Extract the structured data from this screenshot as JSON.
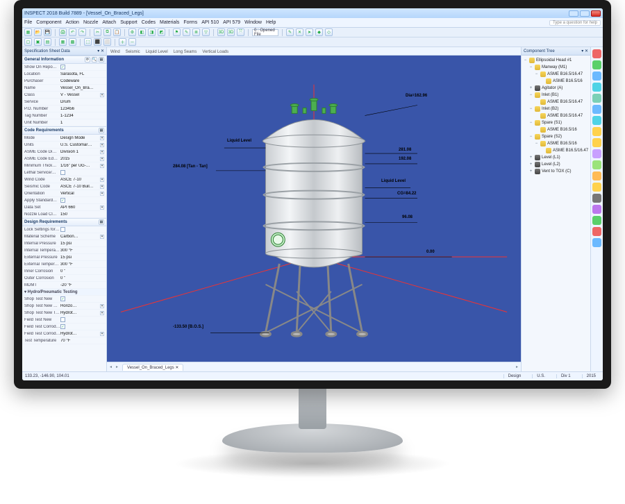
{
  "title": "INSPECT 2018 Build 7889 - [Vessel_On_Braced_Legs]",
  "menus": [
    "File",
    "Component",
    "Action",
    "Nozzle",
    "Attach",
    "Support",
    "Codes",
    "Materials",
    "Forms",
    "API 510",
    "API 579",
    "Window",
    "Help"
  ],
  "help_placeholder": "Type a question for help",
  "toolbar2": {
    "opened_file_label": "0 : Opened File"
  },
  "view_tabs": [
    "Wind",
    "Seismic",
    "Liquid Level",
    "Long Seams",
    "Vertical Loads"
  ],
  "doc_tab": "Vessel_On_Braced_Legs",
  "status": {
    "coords": "133.23, -146.90, 104.01",
    "design": "Design",
    "units": "U.S.",
    "div": "Div 1",
    "year": "2015"
  },
  "left_panel_title": "Specification Sheet Data",
  "right_panel_title": "Component Tree",
  "general": {
    "title": "General Information",
    "rows": [
      {
        "k": "Show On Repo…",
        "v": "",
        "check": true,
        "checked": true
      },
      {
        "k": "Location",
        "v": "Sarasota, FL"
      },
      {
        "k": "Purchaser",
        "v": "Codeware"
      },
      {
        "k": "Name",
        "v": "Vessel_On_Bra…"
      },
      {
        "k": "Class",
        "v": "V - Vessel",
        "dd": true
      },
      {
        "k": "Service",
        "v": "Drum"
      },
      {
        "k": "P.O. Number",
        "v": "123456"
      },
      {
        "k": "Tag Number",
        "v": "1-1234"
      },
      {
        "k": "Unit Number",
        "v": "1"
      }
    ]
  },
  "code": {
    "title": "Code Requirements",
    "rows": [
      {
        "k": "Mode",
        "v": "Design Mode",
        "dd": true
      },
      {
        "k": "Units",
        "v": "U.S. Customar…",
        "dd": true
      },
      {
        "k": "ASME Code Di…",
        "v": "Division 1",
        "dd": true
      },
      {
        "k": "ASME Code Ed…",
        "v": "2015",
        "dd": true
      },
      {
        "k": "Minimum Thick…",
        "v": "1/16\" per UG-…",
        "dd": true
      },
      {
        "k": "Lethal Service/…",
        "v": "",
        "check": true,
        "checked": false
      },
      {
        "k": "Wind Code",
        "v": "ASCE 7-10",
        "dd": true
      },
      {
        "k": "Seismic Code",
        "v": "ASCE 7-10 Buil…",
        "dd": true
      },
      {
        "k": "Orientation",
        "v": "Vertical",
        "dd": true
      },
      {
        "k": "Apply Standard…",
        "v": "",
        "check": true,
        "checked": true
      },
      {
        "k": "Data Set",
        "v": "API 660",
        "dd": true
      },
      {
        "k": "Nozzle Load Cl…",
        "v": "150"
      }
    ]
  },
  "design": {
    "title": "Design Requirements",
    "rows": [
      {
        "k": "Lock Settings for Indivi…",
        "v": "",
        "check": true,
        "checked": false
      },
      {
        "k": "Material Scheme",
        "v": "Carbon…",
        "dd": true
      },
      {
        "k": "Internal Pressure",
        "v": "15 psi"
      },
      {
        "k": "Internal Temperature",
        "v": "300 °F"
      },
      {
        "k": "External Pressure",
        "v": "15 psi"
      },
      {
        "k": "External Temperature",
        "v": "300 °F"
      },
      {
        "k": "Inner Corrosion",
        "v": "0 \""
      },
      {
        "k": "Outer Corrosion",
        "v": "0 \""
      },
      {
        "k": "MDMT",
        "v": "-20 °F"
      },
      {
        "k": "Hydro/Pneumatic Testing",
        "section": true
      },
      {
        "k": "Shop Test New",
        "v": "",
        "check": true,
        "checked": true
      },
      {
        "k": "Shop Test New Ori…",
        "v": "Horizo…",
        "dd": true
      },
      {
        "k": "Shop Test New Te…",
        "v": "Hydrot…",
        "dd": true
      },
      {
        "k": "Field Test New",
        "v": "",
        "check": true,
        "checked": false
      },
      {
        "k": "Field Test Corroded",
        "v": "",
        "check": true,
        "checked": true
      },
      {
        "k": "Field Test Corroded…",
        "v": "Hydrot…",
        "dd": true
      },
      {
        "k": "Test Temperature",
        "v": "70 °F"
      }
    ]
  },
  "tree": [
    {
      "l": 0,
      "tw": "−",
      "ico": "cyl",
      "t": "Ellipsoidal Head #1"
    },
    {
      "l": 1,
      "tw": "−",
      "ico": "cyl",
      "t": "Manway (M1)"
    },
    {
      "l": 2,
      "tw": "−",
      "ico": "cyl",
      "t": "ASME B16.5/16.47"
    },
    {
      "l": 3,
      "tw": "",
      "ico": "cyl",
      "t": "ASME B16.5/16"
    },
    {
      "l": 1,
      "tw": "+",
      "ico": "doc",
      "t": "Agitator (A)"
    },
    {
      "l": 1,
      "tw": "−",
      "ico": "cyl",
      "t": "Inlet (B1)"
    },
    {
      "l": 2,
      "tw": "",
      "ico": "cyl",
      "t": "ASME B16.5/16.47"
    },
    {
      "l": 1,
      "tw": "−",
      "ico": "cyl",
      "t": "Inlet (B2)"
    },
    {
      "l": 2,
      "tw": "",
      "ico": "cyl",
      "t": "ASME B16.5/16.47"
    },
    {
      "l": 1,
      "tw": "−",
      "ico": "cyl",
      "t": "Spare (S1)"
    },
    {
      "l": 2,
      "tw": "",
      "ico": "cyl",
      "t": "ASME B16.5/16"
    },
    {
      "l": 1,
      "tw": "−",
      "ico": "cyl",
      "t": "Spare (S2)"
    },
    {
      "l": 2,
      "tw": "−",
      "ico": "cyl",
      "t": "ASME B16.5/16"
    },
    {
      "l": 3,
      "tw": "",
      "ico": "cyl",
      "t": "ASME B16.5/16.47"
    },
    {
      "l": 1,
      "tw": "+",
      "ico": "doc",
      "t": "Level (L1)"
    },
    {
      "l": 1,
      "tw": "+",
      "ico": "doc",
      "t": "Level (L2)"
    },
    {
      "l": 1,
      "tw": "+",
      "ico": "doc",
      "t": "Vent to TOX (C)"
    }
  ],
  "dims": {
    "dia": "Dia=162.96",
    "liq_top": "Liquid Level",
    "liq_mid": "Liquid Level",
    "d281": "281.08",
    "d192": "192.08",
    "cg": "CG=84.22",
    "d96": "96.08",
    "zero": "0.00",
    "tan": "284.08 [Tan - Tan]",
    "bos": "-133.50 [B.O.S.]"
  }
}
